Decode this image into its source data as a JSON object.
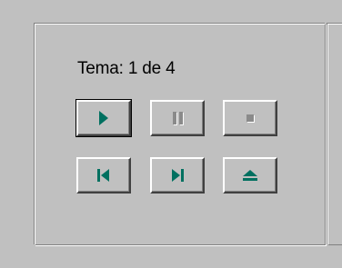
{
  "player": {
    "track_label": "Tema: 1 de 4"
  },
  "controls": [
    {
      "id": "play",
      "icon": "play-icon",
      "enabled": true,
      "focused": true
    },
    {
      "id": "pause",
      "icon": "pause-icon",
      "enabled": false
    },
    {
      "id": "stop",
      "icon": "stop-icon",
      "enabled": false
    },
    {
      "id": "previous",
      "icon": "previous-track-icon",
      "enabled": true
    },
    {
      "id": "next",
      "icon": "next-track-icon",
      "enabled": true
    },
    {
      "id": "eject",
      "icon": "eject-icon",
      "enabled": true
    }
  ],
  "colors": {
    "enabled_icon": "#007060",
    "disabled_icon_light": "#ffffff",
    "disabled_icon_dark": "#808080",
    "face": "#c0c0c0"
  }
}
